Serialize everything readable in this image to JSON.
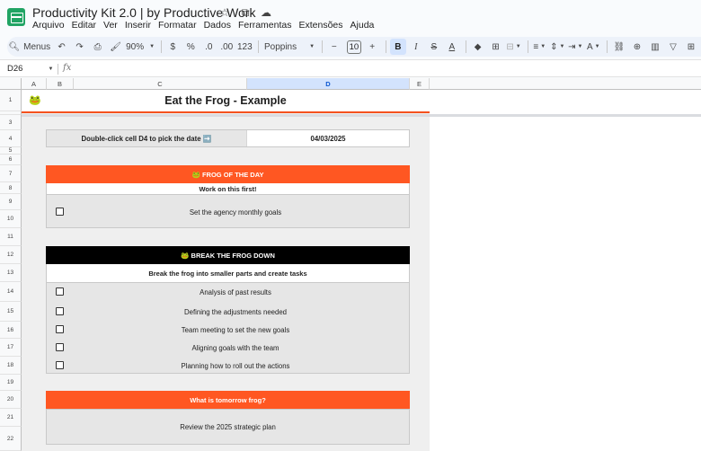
{
  "app": {
    "doc_title": "Productivity Kit 2.0 | by Productive Work",
    "menu": [
      "Arquivo",
      "Editar",
      "Ver",
      "Inserir",
      "Formatar",
      "Dados",
      "Ferramentas",
      "Extensões",
      "Ajuda"
    ],
    "title_icons": [
      "☆",
      "⧉",
      "☁"
    ]
  },
  "toolbar": {
    "menus_label": "Menus",
    "zoom": "90%",
    "currency": "$",
    "percent": "%",
    "dec_decrease": ".0",
    "dec_increase": ".00",
    "number_format": "123",
    "font": "Poppins",
    "font_size": "10",
    "bold": "B",
    "italic": "I",
    "strike": "S",
    "text_color": "A",
    "fill": "◆",
    "borders": "⊞",
    "merge": "⊟",
    "align_h": "≡",
    "align_v": "⇕",
    "wrap": "⇥",
    "rotate": "A",
    "link": "⛓",
    "comment": "⊕",
    "chart": "▥",
    "filter": "▽",
    "functions": "⊞"
  },
  "formula_bar": {
    "cell_ref": "D26",
    "fx": "fx",
    "content": ""
  },
  "grid": {
    "columns": [
      "A",
      "B",
      "C",
      "D",
      "E"
    ],
    "rows": [
      "1",
      "2",
      "3",
      "4",
      "5",
      "6",
      "7",
      "8",
      "9",
      "10",
      "11",
      "12",
      "13",
      "14",
      "15",
      "16",
      "17",
      "18",
      "19",
      "20",
      "21",
      "22"
    ]
  },
  "sheet": {
    "title_emoji": "🐸",
    "title": "Eat the Frog - Example",
    "date_prompt": "Double-click cell D4 to pick the date ➡️",
    "date_value": "04/03/2025",
    "frog_header": "🐸 FROG OF THE DAY",
    "frog_sub": "Work on this first!",
    "frog_task": "Set the agency monthly goals",
    "break_header": "🐸 BREAK THE FROG DOWN",
    "break_sub": "Break the frog into smaller parts and create tasks",
    "break_tasks": [
      "Analysis of past results",
      "Defining the adjustments needed",
      "Team meeting to set the new goals",
      "Aligning goals with the team",
      "Planning how to roll out the actions"
    ],
    "tomorrow_header": "What is tomorrow frog?",
    "tomorrow_text": "Review the 2025 strategic plan"
  },
  "colors": {
    "orange": "#ff5722",
    "black": "#000000",
    "panel": "#e6e6e6",
    "accent_blue": "#d3e3fd"
  }
}
